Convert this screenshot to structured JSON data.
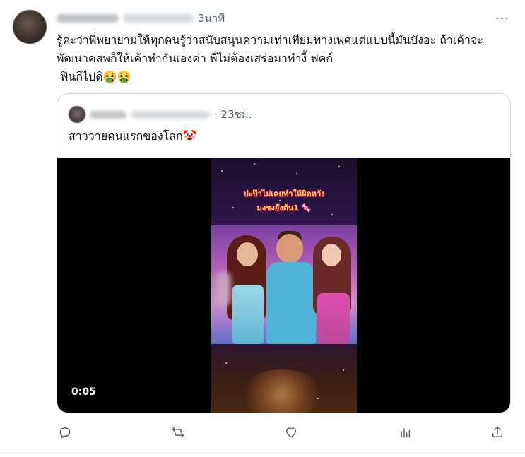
{
  "tweet": {
    "time": "3นาที",
    "more_label": "···",
    "text": "รู้ค่ะว่าพี่พยายามให้ทุกคนรู้ว่าสนับสนุนความเท่าเทียมทางเพศแต่แบบนี้มันบังอะ ถ้าเค้าจะพัฒนาคสพก็ให้เค้าทำกันเองค่า พี่ไม่ต้องเสร่อมาทำงี้ ฟคก์\n ฟินกีไปดิ🤮🤮"
  },
  "quote": {
    "time": "· 23ชม.",
    "text": "สาววายคนแรกของโลก🤡",
    "video": {
      "caption_line1": "ปะป๊าไม่เคยทำให้ผิดหวัง",
      "caption_line2": "มงชงยังต้น1 🍬",
      "duration": "0:05"
    }
  },
  "actions": {
    "reply": "reply-icon",
    "retweet": "retweet-icon",
    "like": "heart-icon",
    "views": "views-icon",
    "share": "share-icon"
  },
  "colors": {
    "text": "#0f1419",
    "secondary": "#536471",
    "border": "#cfd9de"
  }
}
